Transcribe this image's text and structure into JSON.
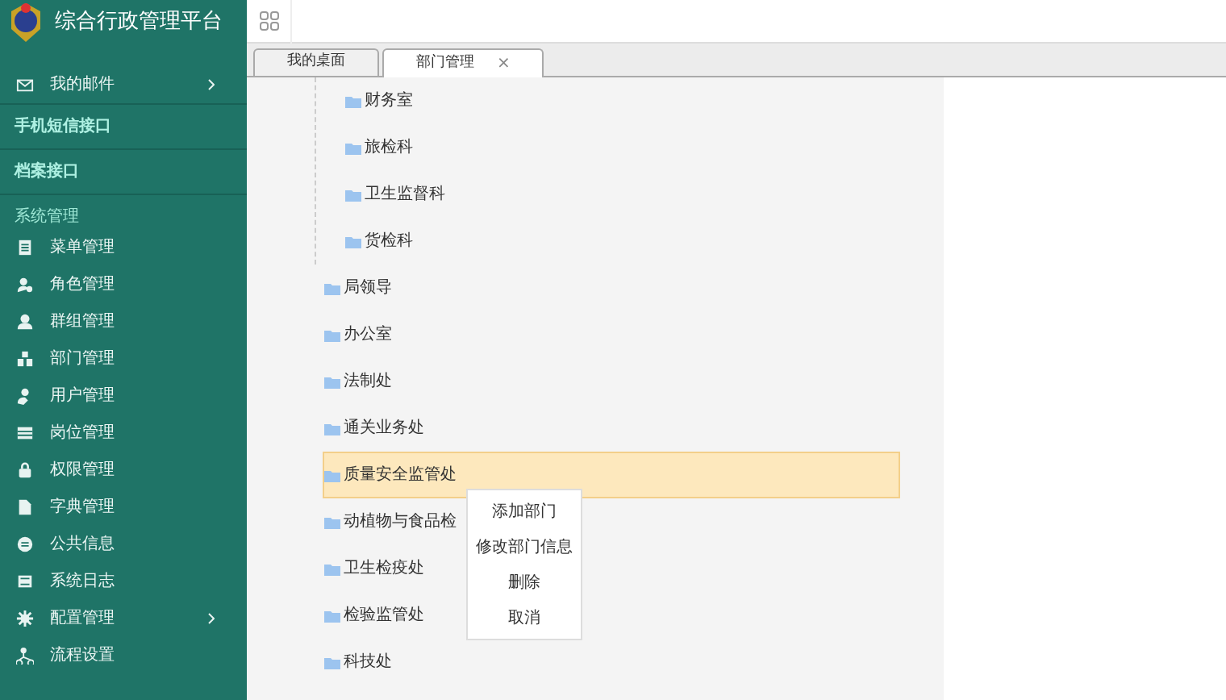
{
  "app": {
    "title": "综合行政管理平台"
  },
  "sidebar": [
    {
      "kind": "item",
      "label": "我的邮件",
      "submenu": true
    },
    {
      "kind": "group",
      "label": "手机短信接口"
    },
    {
      "kind": "group",
      "label": "档案接口"
    },
    {
      "kind": "section",
      "label": "系统管理"
    },
    {
      "kind": "item",
      "label": "菜单管理",
      "submenu": false
    },
    {
      "kind": "item",
      "label": "角色管理",
      "submenu": false
    },
    {
      "kind": "item",
      "label": "群组管理",
      "submenu": false
    },
    {
      "kind": "item",
      "label": "部门管理",
      "submenu": false
    },
    {
      "kind": "item",
      "label": "用户管理",
      "submenu": false
    },
    {
      "kind": "item",
      "label": "岗位管理",
      "submenu": false
    },
    {
      "kind": "item",
      "label": "权限管理",
      "submenu": false
    },
    {
      "kind": "item",
      "label": "字典管理",
      "submenu": false
    },
    {
      "kind": "item",
      "label": "公共信息",
      "submenu": false
    },
    {
      "kind": "item",
      "label": "系统日志",
      "submenu": false
    },
    {
      "kind": "item",
      "label": "配置管理",
      "submenu": true
    },
    {
      "kind": "item",
      "label": "流程设置",
      "submenu": false
    }
  ],
  "tabs": [
    {
      "label": "我的桌面",
      "selected": false,
      "closable": false
    },
    {
      "label": "部门管理",
      "selected": true,
      "closable": true,
      "close": "×"
    }
  ],
  "tree": [
    {
      "children": [
        {
          "label": "财务室",
          "selected": false
        },
        {
          "label": "旅检科",
          "selected": false
        },
        {
          "label": "卫生监督科",
          "selected": false
        },
        {
          "label": "货检科",
          "selected": false
        }
      ]
    },
    {
      "label": "局领导",
      "selected": false
    },
    {
      "label": "办公室",
      "selected": false
    },
    {
      "label": "法制处",
      "selected": false
    },
    {
      "label": "通关业务处",
      "selected": false
    },
    {
      "label": "质量安全监管处",
      "selected": true
    },
    {
      "label": "动植物与食品检",
      "selected": false
    },
    {
      "label": "卫生检疫处",
      "selected": false
    },
    {
      "label": "检验监管处",
      "selected": false
    },
    {
      "label": "科技处",
      "selected": false
    }
  ],
  "context_menu": [
    "添加部门",
    "修改部门信息",
    "删除",
    "取消"
  ]
}
